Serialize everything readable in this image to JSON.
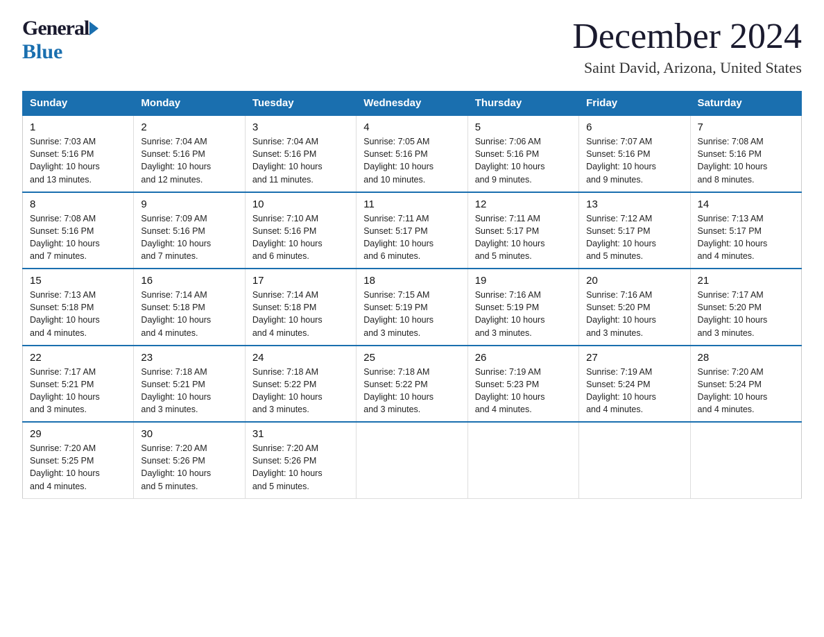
{
  "header": {
    "logo_general": "General",
    "logo_blue": "Blue",
    "month_title": "December 2024",
    "location": "Saint David, Arizona, United States"
  },
  "days_of_week": [
    "Sunday",
    "Monday",
    "Tuesday",
    "Wednesday",
    "Thursday",
    "Friday",
    "Saturday"
  ],
  "weeks": [
    [
      {
        "day": "1",
        "sunrise": "7:03 AM",
        "sunset": "5:16 PM",
        "daylight": "10 hours and 13 minutes."
      },
      {
        "day": "2",
        "sunrise": "7:04 AM",
        "sunset": "5:16 PM",
        "daylight": "10 hours and 12 minutes."
      },
      {
        "day": "3",
        "sunrise": "7:04 AM",
        "sunset": "5:16 PM",
        "daylight": "10 hours and 11 minutes."
      },
      {
        "day": "4",
        "sunrise": "7:05 AM",
        "sunset": "5:16 PM",
        "daylight": "10 hours and 10 minutes."
      },
      {
        "day": "5",
        "sunrise": "7:06 AM",
        "sunset": "5:16 PM",
        "daylight": "10 hours and 9 minutes."
      },
      {
        "day": "6",
        "sunrise": "7:07 AM",
        "sunset": "5:16 PM",
        "daylight": "10 hours and 9 minutes."
      },
      {
        "day": "7",
        "sunrise": "7:08 AM",
        "sunset": "5:16 PM",
        "daylight": "10 hours and 8 minutes."
      }
    ],
    [
      {
        "day": "8",
        "sunrise": "7:08 AM",
        "sunset": "5:16 PM",
        "daylight": "10 hours and 7 minutes."
      },
      {
        "day": "9",
        "sunrise": "7:09 AM",
        "sunset": "5:16 PM",
        "daylight": "10 hours and 7 minutes."
      },
      {
        "day": "10",
        "sunrise": "7:10 AM",
        "sunset": "5:16 PM",
        "daylight": "10 hours and 6 minutes."
      },
      {
        "day": "11",
        "sunrise": "7:11 AM",
        "sunset": "5:17 PM",
        "daylight": "10 hours and 6 minutes."
      },
      {
        "day": "12",
        "sunrise": "7:11 AM",
        "sunset": "5:17 PM",
        "daylight": "10 hours and 5 minutes."
      },
      {
        "day": "13",
        "sunrise": "7:12 AM",
        "sunset": "5:17 PM",
        "daylight": "10 hours and 5 minutes."
      },
      {
        "day": "14",
        "sunrise": "7:13 AM",
        "sunset": "5:17 PM",
        "daylight": "10 hours and 4 minutes."
      }
    ],
    [
      {
        "day": "15",
        "sunrise": "7:13 AM",
        "sunset": "5:18 PM",
        "daylight": "10 hours and 4 minutes."
      },
      {
        "day": "16",
        "sunrise": "7:14 AM",
        "sunset": "5:18 PM",
        "daylight": "10 hours and 4 minutes."
      },
      {
        "day": "17",
        "sunrise": "7:14 AM",
        "sunset": "5:18 PM",
        "daylight": "10 hours and 4 minutes."
      },
      {
        "day": "18",
        "sunrise": "7:15 AM",
        "sunset": "5:19 PM",
        "daylight": "10 hours and 3 minutes."
      },
      {
        "day": "19",
        "sunrise": "7:16 AM",
        "sunset": "5:19 PM",
        "daylight": "10 hours and 3 minutes."
      },
      {
        "day": "20",
        "sunrise": "7:16 AM",
        "sunset": "5:20 PM",
        "daylight": "10 hours and 3 minutes."
      },
      {
        "day": "21",
        "sunrise": "7:17 AM",
        "sunset": "5:20 PM",
        "daylight": "10 hours and 3 minutes."
      }
    ],
    [
      {
        "day": "22",
        "sunrise": "7:17 AM",
        "sunset": "5:21 PM",
        "daylight": "10 hours and 3 minutes."
      },
      {
        "day": "23",
        "sunrise": "7:18 AM",
        "sunset": "5:21 PM",
        "daylight": "10 hours and 3 minutes."
      },
      {
        "day": "24",
        "sunrise": "7:18 AM",
        "sunset": "5:22 PM",
        "daylight": "10 hours and 3 minutes."
      },
      {
        "day": "25",
        "sunrise": "7:18 AM",
        "sunset": "5:22 PM",
        "daylight": "10 hours and 3 minutes."
      },
      {
        "day": "26",
        "sunrise": "7:19 AM",
        "sunset": "5:23 PM",
        "daylight": "10 hours and 4 minutes."
      },
      {
        "day": "27",
        "sunrise": "7:19 AM",
        "sunset": "5:24 PM",
        "daylight": "10 hours and 4 minutes."
      },
      {
        "day": "28",
        "sunrise": "7:20 AM",
        "sunset": "5:24 PM",
        "daylight": "10 hours and 4 minutes."
      }
    ],
    [
      {
        "day": "29",
        "sunrise": "7:20 AM",
        "sunset": "5:25 PM",
        "daylight": "10 hours and 4 minutes."
      },
      {
        "day": "30",
        "sunrise": "7:20 AM",
        "sunset": "5:26 PM",
        "daylight": "10 hours and 5 minutes."
      },
      {
        "day": "31",
        "sunrise": "7:20 AM",
        "sunset": "5:26 PM",
        "daylight": "10 hours and 5 minutes."
      },
      null,
      null,
      null,
      null
    ]
  ],
  "labels": {
    "sunrise": "Sunrise:",
    "sunset": "Sunset:",
    "daylight": "Daylight:"
  }
}
